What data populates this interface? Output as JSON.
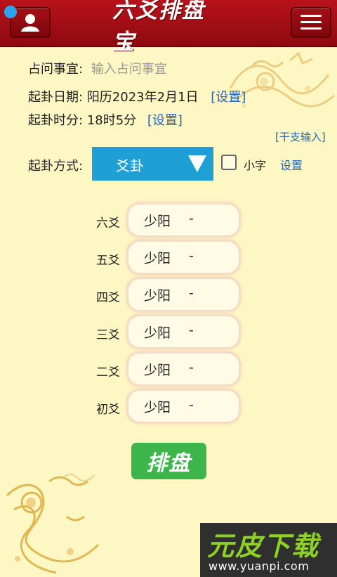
{
  "header": {
    "logo_text": "六爻排盘宝",
    "user_icon": "user-icon",
    "menu_icon": "hamburger-menu-icon"
  },
  "form": {
    "question_label": "占问事宜:",
    "question_placeholder": "输入占问事宜",
    "date_label": "起卦日期:",
    "date_value": "阳历2023年2月1日",
    "date_set_link": "[设置]",
    "time_label": "起卦时分:",
    "time_value": "18时5分",
    "time_set_link": "[设置]",
    "ganzhi_link": "[干支输入]",
    "method_label": "起卦方式:",
    "method_selected": "爻卦",
    "small_font_label": "小字",
    "settings_link": "设置"
  },
  "yao": [
    {
      "label": "六爻",
      "value": "少阳",
      "mark": "-"
    },
    {
      "label": "五爻",
      "value": "少阳",
      "mark": "-"
    },
    {
      "label": "四爻",
      "value": "少阳",
      "mark": "-"
    },
    {
      "label": "三爻",
      "value": "少阳",
      "mark": "-"
    },
    {
      "label": "二爻",
      "value": "少阳",
      "mark": "-"
    },
    {
      "label": "初爻",
      "value": "少阳",
      "mark": "-"
    }
  ],
  "paipan_button": "排盘",
  "watermark": {
    "title": "元皮下载",
    "url": "www.yuanpi.com"
  },
  "colors": {
    "header": "#a30e16",
    "background": "#fdf7c4",
    "select": "#1ea0d4",
    "button": "#3cb54a",
    "link": "#2c63b2"
  }
}
